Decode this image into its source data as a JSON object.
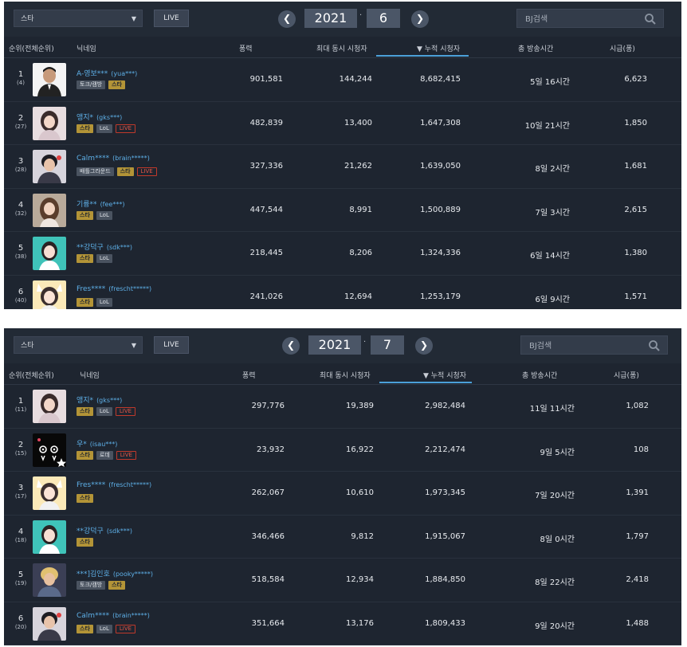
{
  "panels": [
    {
      "filter": {
        "category": "스타",
        "live_label": "LIVE"
      },
      "period": {
        "year": "2021",
        "month": "6",
        "separator": "·",
        "prev": "❮",
        "next": "❯"
      },
      "search": {
        "placeholder": "BJ검색"
      },
      "columns": {
        "rank": "순위(전체순위)",
        "nickname": "닉네임",
        "power": "퐁력",
        "peak": "최대 동시 시청자",
        "cumulative": "▼ 누적 시청자",
        "hours": "총 방송시간",
        "hourly": "시급(퐁)"
      },
      "rows": [
        {
          "rank": "1",
          "overall": "(4)",
          "name": "A-영보***",
          "uid": "(yua***)",
          "badges": [
            {
              "t": "토크/캠방",
              "k": "gray"
            },
            {
              "t": "스타",
              "k": "gold"
            }
          ],
          "power": "901,581",
          "peak": "144,244",
          "cumulative": "8,682,415",
          "hours": "5일 16시간",
          "hourly": "6,623",
          "avatar": "man-suit"
        },
        {
          "rank": "2",
          "overall": "(27)",
          "name": "앵지*",
          "uid": "(gks***)",
          "badges": [
            {
              "t": "스타",
              "k": "gold"
            },
            {
              "t": "LoL",
              "k": "gray"
            },
            {
              "t": "LIVE",
              "k": "live"
            }
          ],
          "power": "482,839",
          "peak": "13,400",
          "cumulative": "1,647,308",
          "hours": "10일 21시간",
          "hourly": "1,850",
          "avatar": "girl-light"
        },
        {
          "rank": "3",
          "overall": "(28)",
          "name": "Calm****",
          "uid": "(brain*****)",
          "badges": [
            {
              "t": "배틀그라운드",
              "k": "gray"
            },
            {
              "t": "스타",
              "k": "gold"
            },
            {
              "t": "LIVE",
              "k": "live"
            }
          ],
          "power": "327,336",
          "peak": "21,262",
          "cumulative": "1,639,050",
          "hours": "8일 2시간",
          "hourly": "1,681",
          "avatar": "boy-dark"
        },
        {
          "rank": "4",
          "overall": "(32)",
          "name": "기륭**",
          "uid": "(fee***)",
          "badges": [
            {
              "t": "스타",
              "k": "gold"
            },
            {
              "t": "LoL",
              "k": "gray"
            }
          ],
          "power": "447,544",
          "peak": "8,991",
          "cumulative": "1,500,889",
          "hours": "7일 3시간",
          "hourly": "2,615",
          "avatar": "girl-brown"
        },
        {
          "rank": "5",
          "overall": "(38)",
          "name": "**강덕구",
          "uid": "(sdk***)",
          "badges": [
            {
              "t": "스타",
              "k": "gold"
            },
            {
              "t": "LoL",
              "k": "gray"
            }
          ],
          "power": "218,445",
          "peak": "8,206",
          "cumulative": "1,324,336",
          "hours": "6일 14시간",
          "hourly": "1,380",
          "avatar": "girl-teal"
        },
        {
          "rank": "6",
          "overall": "(40)",
          "name": "Fres****",
          "uid": "(frescht*****)",
          "badges": [
            {
              "t": "스타",
              "k": "gold"
            },
            {
              "t": "LoL",
              "k": "gray"
            }
          ],
          "power": "241,026",
          "peak": "12,694",
          "cumulative": "1,253,179",
          "hours": "6일 9시간",
          "hourly": "1,571",
          "avatar": "girl-cat"
        }
      ]
    },
    {
      "filter": {
        "category": "스타",
        "live_label": "LIVE"
      },
      "period": {
        "year": "2021",
        "month": "7",
        "separator": "·",
        "prev": "❮",
        "next": "❯"
      },
      "search": {
        "placeholder": "BJ검색"
      },
      "columns": {
        "rank": "순위(전체순위)",
        "nickname": "닉네임",
        "power": "퐁력",
        "peak": "최대 동시 시청자",
        "cumulative": "▼ 누적 시청자",
        "hours": "총 방송시간",
        "hourly": "시급(퐁)"
      },
      "rows": [
        {
          "rank": "1",
          "overall": "(11)",
          "name": "앵지*",
          "uid": "(gks***)",
          "badges": [
            {
              "t": "스타",
              "k": "gold"
            },
            {
              "t": "LoL",
              "k": "gray"
            },
            {
              "t": "LIVE",
              "k": "live"
            }
          ],
          "power": "297,776",
          "peak": "19,389",
          "cumulative": "2,982,484",
          "hours": "11일 11시간",
          "hourly": "1,082",
          "avatar": "girl-light"
        },
        {
          "rank": "2",
          "overall": "(15)",
          "name": "우*",
          "uid": "(isau***)",
          "badges": [
            {
              "t": "스타",
              "k": "gold"
            },
            {
              "t": "로데",
              "k": "gray"
            },
            {
              "t": "LIVE",
              "k": "live"
            }
          ],
          "power": "23,932",
          "peak": "16,922",
          "cumulative": "2,212,474",
          "hours": "9일 5시간",
          "hourly": "108",
          "avatar": "black-logo"
        },
        {
          "rank": "3",
          "overall": "(17)",
          "name": "Fres****",
          "uid": "(frescht*****)",
          "badges": [
            {
              "t": "스타",
              "k": "gold"
            }
          ],
          "power": "262,067",
          "peak": "10,610",
          "cumulative": "1,973,345",
          "hours": "7일 20시간",
          "hourly": "1,391",
          "avatar": "girl-cat"
        },
        {
          "rank": "4",
          "overall": "(18)",
          "name": "**강덕구",
          "uid": "(sdk***)",
          "badges": [
            {
              "t": "스타",
              "k": "gold"
            }
          ],
          "power": "346,466",
          "peak": "9,812",
          "cumulative": "1,915,067",
          "hours": "8일 0시간",
          "hourly": "1,797",
          "avatar": "girl-teal"
        },
        {
          "rank": "5",
          "overall": "(19)",
          "name": "***]김인호",
          "uid": "(pooky*****)",
          "badges": [
            {
              "t": "토크/캠방",
              "k": "gray"
            },
            {
              "t": "스타",
              "k": "gold"
            }
          ],
          "power": "518,584",
          "peak": "12,934",
          "cumulative": "1,884,850",
          "hours": "8일 22시간",
          "hourly": "2,418",
          "avatar": "boy-blond"
        },
        {
          "rank": "6",
          "overall": "(20)",
          "name": "Calm****",
          "uid": "(brain*****)",
          "badges": [
            {
              "t": "스타",
              "k": "gold"
            },
            {
              "t": "LoL",
              "k": "gray"
            },
            {
              "t": "LIVE",
              "k": "live"
            }
          ],
          "power": "351,664",
          "peak": "13,176",
          "cumulative": "1,809,433",
          "hours": "9일 20시간",
          "hourly": "1,488",
          "avatar": "boy-dark"
        }
      ]
    }
  ]
}
